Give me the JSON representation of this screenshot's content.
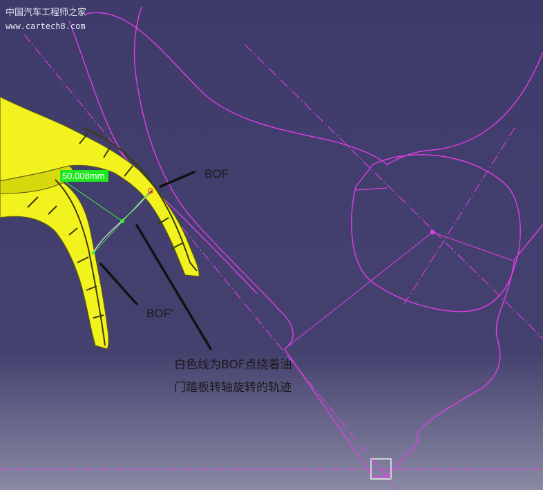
{
  "watermark": {
    "title": "中国汽车工程师之家",
    "url": "www.cartech8.com"
  },
  "labels": {
    "bof": "BOF",
    "bof_prime": "BOF'",
    "note_line1": "白色线为BOF点绕着油",
    "note_line2": "门踏板转轴旋转的轨迹"
  },
  "dimension": {
    "value": "50.008mm"
  },
  "colors": {
    "bg_top": "#3e3a6a",
    "bg_bottom": "#8a8aa4",
    "curve": "#e23ee6",
    "pedal": "#f2f21e",
    "dim_bg": "#1ee81e"
  }
}
